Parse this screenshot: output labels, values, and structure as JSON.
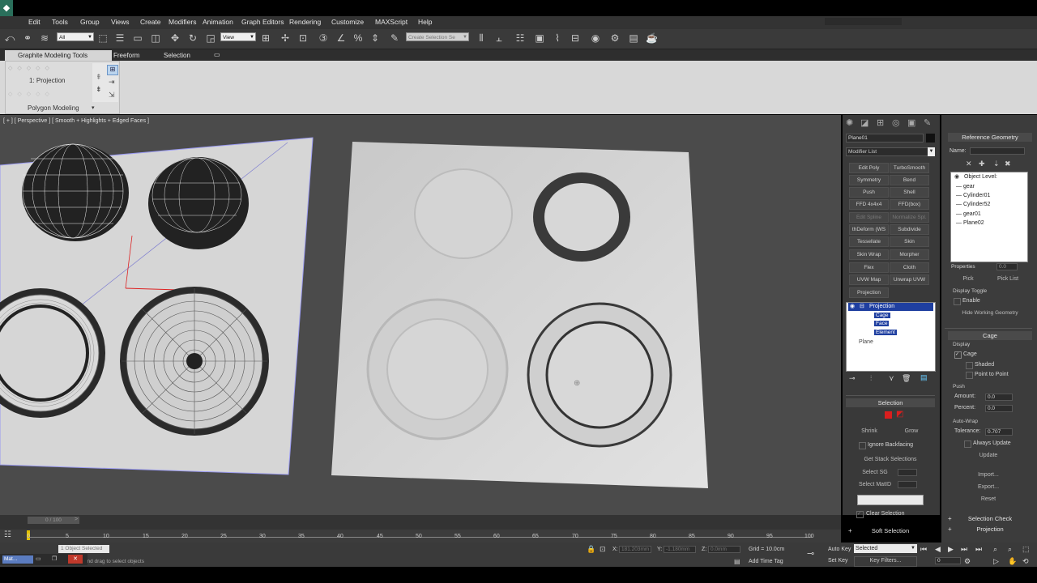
{
  "menu": {
    "logo": "◆",
    "items": [
      "Edit",
      "Tools",
      "Group",
      "Views",
      "Create",
      "Modifiers",
      "Animation",
      "Graph Editors",
      "Rendering",
      "Customize",
      "MAXScript",
      "Help"
    ]
  },
  "toolbar": {
    "selection_filter": "All",
    "reference_coord": "View",
    "named_selection": "Create Selection Se"
  },
  "ribbon": {
    "tabs": [
      "Graphite Modeling Tools",
      "Freeform",
      "Selection"
    ],
    "panel_item": "1: Projection",
    "panel_title": "Polygon Modeling"
  },
  "viewport": {
    "label": "[ + ] [ Perspective ] [ Smooth + Highlights + Edged Faces ]"
  },
  "command_panel": {
    "object_name": "Plane01",
    "modifier_list": "Modifier List",
    "modifier_buttons": [
      [
        "Edit Poly",
        "TurboSmooth"
      ],
      [
        "Symmetry",
        "Bend"
      ],
      [
        "Push",
        "Shell"
      ],
      [
        "FFD 4x4x4",
        "FFD(box)"
      ],
      [
        "Edit Spline",
        "Normalize Spl."
      ],
      [
        "thDeform (WS",
        "Subdivide"
      ],
      [
        "Tessellate",
        "Skin"
      ],
      [
        "Skin Wrap",
        "Morpher"
      ],
      [
        "Flex",
        "Cloth"
      ],
      [
        "UVW Map",
        "Unwrap UVW"
      ],
      [
        "Projection",
        ""
      ]
    ],
    "stack": {
      "items": [
        "Projection",
        "Cage",
        "Face",
        "Element"
      ],
      "base": "Plane"
    },
    "selection_title": "Selection",
    "shrink": "Shrink",
    "grow": "Grow",
    "ignore_backfacing": "Ignore Backfacing",
    "get_stack_selections": "Get Stack Selections",
    "select_sg": "Select SG",
    "select_mat_id": "Select MatID",
    "clear_selection": "Clear Selection",
    "soft_selection": "Soft Selection"
  },
  "reference_geometry": {
    "title": "Reference Geometry",
    "name_label": "Name:",
    "object_level": "Object Level:",
    "objects": [
      "gear",
      "Cylinder01",
      "Cylinder52",
      "gear01",
      "Plane02"
    ],
    "properties_label": "Properties",
    "properties_value": "0.0",
    "pick": "Pick",
    "pick_list": "Pick List",
    "display_toggle": "Display Toggle",
    "enable": "Enable",
    "hide_working": "Hide Working Geometry"
  },
  "cage": {
    "title": "Cage",
    "display": "Display",
    "cage_label": "Cage",
    "shaded": "Shaded",
    "point_to_point": "Point to Point",
    "push": "Push",
    "amount_label": "Amount:",
    "amount_value": "0.0",
    "percent_label": "Percent:",
    "percent_value": "0.0",
    "auto_wrap": "Auto-Wrap",
    "tolerance_label": "Tolerance:",
    "tolerance_value": "0.707",
    "always_update": "Always Update",
    "update": "Update",
    "import": "Import...",
    "export": "Export...",
    "reset": "Reset",
    "selection_check": "Selection Check",
    "projection": "Projection"
  },
  "timeline": {
    "slider": "0 / 100",
    "ticks": [
      "0",
      "5",
      "10",
      "15",
      "20",
      "25",
      "30",
      "35",
      "40",
      "45",
      "50",
      "55",
      "60",
      "65",
      "70",
      "75",
      "80",
      "85",
      "90",
      "95",
      "100"
    ]
  },
  "status": {
    "selected": "1 Object Selected",
    "prompt": "Click and drag to select objects",
    "x_label": "X:",
    "x_value": "181.203mm",
    "y_label": "Y:",
    "y_value": "-1.180mm",
    "z_label": "Z:",
    "z_value": "0.0mm",
    "grid": "Grid = 10.0cm",
    "add_time_tag": "Add Time Tag",
    "auto_key": "Auto Key",
    "set_key": "Set Key",
    "key_mode": "Selected",
    "key_filters": "Key Filters...",
    "frame": "0",
    "taskbar_app": "Mat..."
  },
  "colors": {
    "accent_red": "#d91e1e",
    "selection_blue": "#1f3fa0",
    "viewport_bg": "#4b4b4b"
  }
}
